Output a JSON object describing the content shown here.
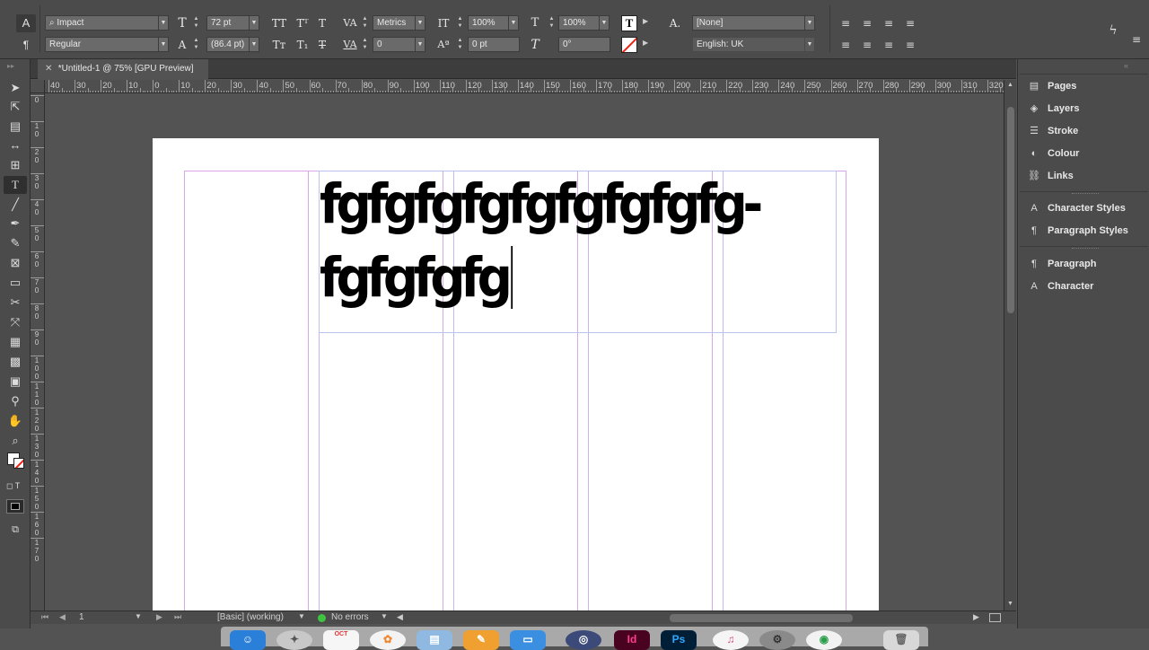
{
  "control_panel": {
    "font_family": "Impact",
    "font_style": "Regular",
    "font_size": "72 pt",
    "leading": "(86.4 pt)",
    "kerning": "Metrics",
    "tracking": "0",
    "vertical_scale": "100%",
    "horizontal_scale": "100%",
    "baseline_shift": "0 pt",
    "skew": "0°",
    "char_style": "[None]",
    "language": "English: UK",
    "caps_buttons": [
      "TT",
      "Tᵀ",
      "T"
    ],
    "small_caps_buttons": [
      "Tт",
      "T₁",
      "T"
    ]
  },
  "document_tab": {
    "title": "*Untitled-1 @ 75% [GPU Preview]"
  },
  "ruler": {
    "h_labels": [
      "40",
      "30",
      "20",
      "10",
      "0",
      "10",
      "20",
      "30",
      "40",
      "50",
      "60",
      "70",
      "80",
      "90",
      "100",
      "110",
      "120",
      "130",
      "140",
      "150",
      "160",
      "170",
      "180",
      "190",
      "200",
      "210",
      "220",
      "230",
      "240",
      "250",
      "260",
      "270",
      "280",
      "290",
      "300",
      "310",
      "320"
    ],
    "v_labels": [
      "0",
      "1 0",
      "2 0",
      "3 0",
      "4 0",
      "5 0",
      "6 0",
      "7 0",
      "8 0",
      "9 0",
      "1 0 0",
      "1 1 0",
      "1 2 0",
      "1 3 0",
      "1 4 0",
      "1 5 0",
      "1 6 0",
      "1 7 0"
    ]
  },
  "document": {
    "line1": "fgfgfgfgfgfgfgfgfg-",
    "line2": "fgfgfgfg"
  },
  "status_bar": {
    "page_number": "1",
    "preflight_profile": "[Basic] (working)",
    "errors": "No errors"
  },
  "panels": {
    "group1": [
      {
        "label": "Pages",
        "icon": "pages-icon"
      },
      {
        "label": "Layers",
        "icon": "layers-icon"
      },
      {
        "label": "Stroke",
        "icon": "stroke-icon"
      },
      {
        "label": "Colour",
        "icon": "colour-icon"
      },
      {
        "label": "Links",
        "icon": "links-icon"
      }
    ],
    "group2": [
      {
        "label": "Character Styles",
        "icon": "character-styles-icon"
      },
      {
        "label": "Paragraph Styles",
        "icon": "paragraph-styles-icon"
      }
    ],
    "group3": [
      {
        "label": "Paragraph",
        "icon": "paragraph-icon"
      },
      {
        "label": "Character",
        "icon": "character-icon"
      }
    ]
  },
  "dock": {
    "calendar_month": "OCT",
    "id_label": "Id",
    "ps_label": "Ps"
  },
  "colors": {
    "app_bg": "#535353",
    "panel_bg": "#4b4b4b",
    "page_bg": "#ffffff",
    "margin_guide": "#d9a6e6",
    "column_guide": "#c6b6f0",
    "text_frame": "#b8c4ea",
    "indesign_pink": "#ff3f8f",
    "photoshop_blue": "#31a8ff"
  }
}
